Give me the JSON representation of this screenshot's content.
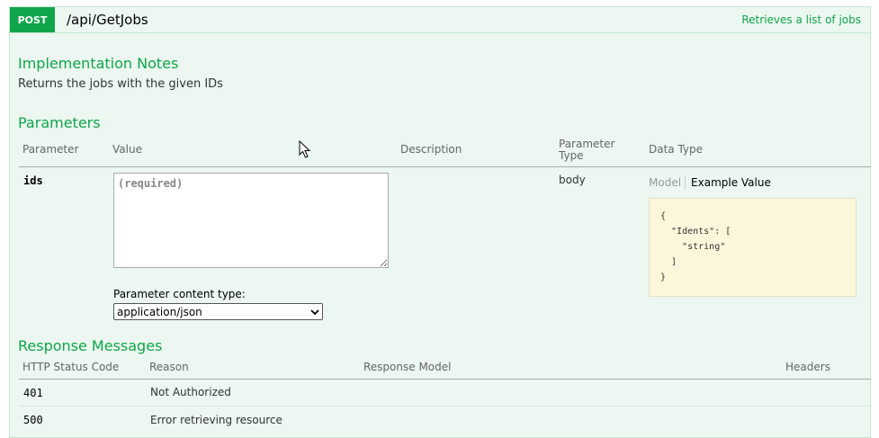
{
  "operation": {
    "method": "POST",
    "path": "/api/GetJobs",
    "summary": "Retrieves a list of jobs"
  },
  "implementation": {
    "heading": "Implementation Notes",
    "notes": "Returns the jobs with the given IDs"
  },
  "parameters": {
    "heading": "Parameters",
    "columns": {
      "parameter": "Parameter",
      "value": "Value",
      "description": "Description",
      "param_type_line1": "Parameter",
      "param_type_line2": "Type",
      "data_type": "Data Type"
    },
    "row": {
      "name": "ids",
      "placeholder": "(required)",
      "type": "body",
      "content_type_label": "Parameter content type:",
      "content_type_value": "application/json",
      "data_type_tabs": {
        "model": "Model",
        "example": "Example Value"
      },
      "example": "{\n  \"Idents\": [\n    \"string\"\n  ]\n}"
    }
  },
  "responses": {
    "heading": "Response Messages",
    "columns": {
      "status": "HTTP Status Code",
      "reason": "Reason",
      "model": "Response Model",
      "headers": "Headers"
    },
    "rows": [
      {
        "code": "401",
        "reason": "Not Authorized"
      },
      {
        "code": "500",
        "reason": "Error retrieving resource"
      }
    ]
  },
  "icons": {
    "cursor": "mouse-pointer-icon",
    "dropdown": "chevron-down-icon"
  },
  "colors": {
    "accent": "#10a54a",
    "panel_bg": "#ebf7f0",
    "example_bg": "#fcf6db"
  }
}
